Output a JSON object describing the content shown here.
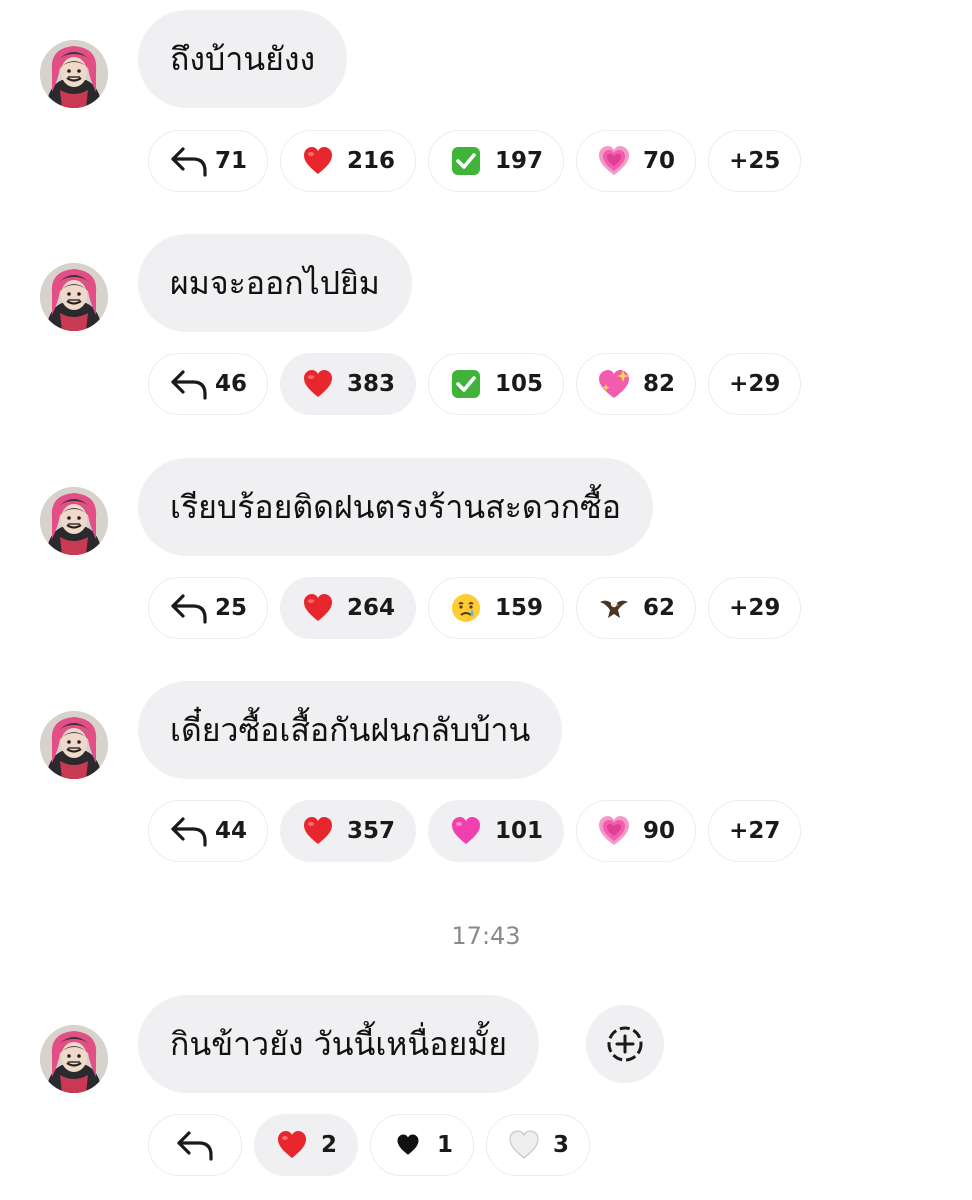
{
  "messages": [
    {
      "text": "ถึงบ้านยังง",
      "reply_count": "71",
      "reactions": [
        {
          "icon": "red-heart-icon",
          "count": "216"
        },
        {
          "icon": "check-mark-button-icon",
          "count": "197"
        },
        {
          "icon": "growing-heart-icon",
          "count": "70"
        }
      ],
      "more": "+25"
    },
    {
      "text": "ผมจะออกไปยิม",
      "reply_count": "46",
      "reactions": [
        {
          "icon": "red-heart-icon",
          "count": "383"
        },
        {
          "icon": "check-mark-button-icon",
          "count": "105"
        },
        {
          "icon": "sparkling-heart-icon",
          "count": "82"
        }
      ],
      "more": "+29"
    },
    {
      "text": "เรียบร้อยติดฝนตรงร้านสะดวกซื้อ",
      "reply_count": "25",
      "reactions": [
        {
          "icon": "red-heart-icon",
          "count": "264"
        },
        {
          "icon": "crying-face-icon",
          "count": "159"
        },
        {
          "icon": "eagle-icon",
          "count": "62"
        }
      ],
      "more": "+29"
    },
    {
      "text": "เดี๋ยวซื้อเสื้อกันฝนกลับบ้าน",
      "reply_count": "44",
      "reactions": [
        {
          "icon": "red-heart-icon",
          "count": "357"
        },
        {
          "icon": "pink-heart-icon",
          "count": "101"
        },
        {
          "icon": "growing-heart-icon",
          "count": "90"
        }
      ],
      "more": "+27"
    }
  ],
  "timestamp": "17:43",
  "last_message": {
    "text": "กินข้าวยัง วันนี้เหนื่อยมั้ย",
    "reactions": [
      {
        "icon": "red-heart-icon",
        "count": "2"
      },
      {
        "icon": "black-heart-icon",
        "count": "1"
      },
      {
        "icon": "white-heart-icon",
        "count": "3"
      }
    ]
  },
  "colors": {
    "bubble": "#f0f0f2",
    "chip_border": "#ececee",
    "heart_red": "#e8262d",
    "check_green": "#3fb33a",
    "pink": "#f25cae",
    "timestamp": "#8a8a8e"
  }
}
